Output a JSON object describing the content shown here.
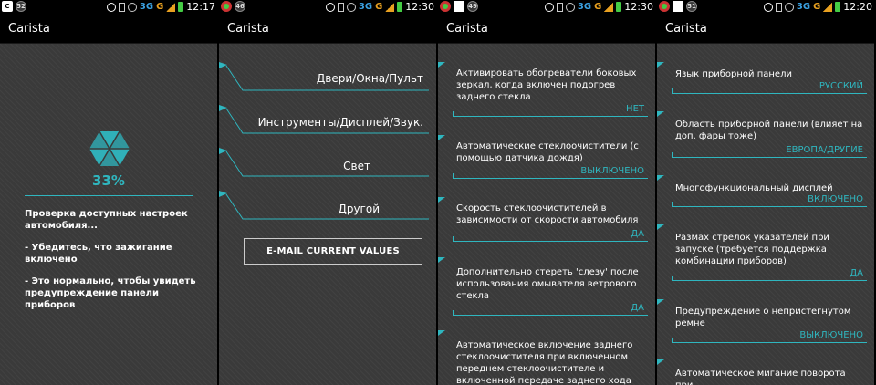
{
  "statusbars": [
    {
      "left_badges": [
        "C",
        "52"
      ],
      "net": "3G",
      "carrier_g": "G",
      "time": "12:17"
    },
    {
      "left_badges": [
        "",
        "46"
      ],
      "net": "3G",
      "carrier_g": "G",
      "time": "12:30"
    },
    {
      "left_badges": [
        "",
        "",
        "49"
      ],
      "net": "3G",
      "carrier_g": "G",
      "time": "12:30"
    },
    {
      "left_badges": [
        "",
        "",
        "51"
      ],
      "net": "3G",
      "carrier_g": "G",
      "time": "12:20"
    }
  ],
  "app_title": "Carista",
  "loading": {
    "percent": "33%",
    "message1": "Проверка доступных настроек автомобиля...",
    "message2": "- Убедитесь, что зажигание включено",
    "message3": "- Это нормально, чтобы увидеть предупреждение панели приборов"
  },
  "categories": {
    "items": [
      "Двери/Окна/Пульт",
      "Инструменты/Дисплей/Звук.",
      "Свет",
      "Другой"
    ],
    "email_button": "E-MAIL CURRENT VALUES"
  },
  "settings_a": [
    {
      "label": "Активировать обогреватели боковых зеркал, когда включен подогрев заднего стекла",
      "value": "НЕТ"
    },
    {
      "label": "Автоматические стеклоочистители (с помощью датчика дождя)",
      "value": "ВЫКЛЮЧЕНО"
    },
    {
      "label": "Скорость стеклоочистителей в зависимости от скорости автомобиля",
      "value": "ДА"
    },
    {
      "label": "Дополнительно стереть 'слезу' после использования омывателя ветрового стекла",
      "value": "ДА"
    },
    {
      "label": "Автоматическое включение заднего стеклоочистителя при включенном переднем стеклоочистителе и включенной передаче заднего хода",
      "value": ""
    }
  ],
  "settings_b": [
    {
      "label": "Язык приборной панели",
      "value": "РУССКИЙ"
    },
    {
      "label": "Область приборной панели (влияет на доп. фары тоже)",
      "value": "ЕВРОПА/ДРУГИЕ"
    },
    {
      "label": "Многофункциональный дисплей",
      "value": "ВКЛЮЧЕНО"
    },
    {
      "label": "Размах стрелок указателей при запуске (требуется поддержка комбинации приборов)",
      "value": "ДА"
    },
    {
      "label": "Предупреждение о непристегнутом ремне",
      "value": "ВЫКЛЮЧЕНО"
    },
    {
      "label": "Автоматическое мигание поворота при",
      "value": ""
    }
  ],
  "colors": {
    "accent": "#2fb6bf",
    "background": "#3a3a3a"
  }
}
